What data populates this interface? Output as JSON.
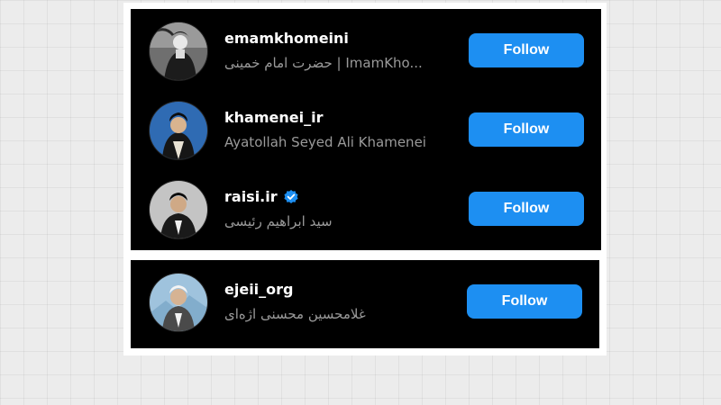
{
  "accounts": [
    {
      "username": "emamkhomeini",
      "subtitle": "حضرت امام خمینی | ImamKho...",
      "verified": false,
      "button_label": "Follow",
      "avatar_icon": "profile-photo"
    },
    {
      "username": "khamenei_ir",
      "subtitle": "Ayatollah Seyed Ali Khamenei",
      "verified": false,
      "button_label": "Follow",
      "avatar_icon": "profile-photo"
    },
    {
      "username": "raisi.ir",
      "subtitle": "سید ابراهیم رئیسی",
      "verified": true,
      "button_label": "Follow",
      "avatar_icon": "profile-photo"
    },
    {
      "username": "ejeii_org",
      "subtitle": "غلامحسین محسنی اژه‌ای",
      "verified": false,
      "button_label": "Follow",
      "avatar_icon": "profile-photo"
    }
  ],
  "colors": {
    "follow_button": "#1d8ff2",
    "panel_bg": "#000000",
    "verified_badge": "#1d8ff2",
    "subtitle": "#9a9a9a"
  }
}
